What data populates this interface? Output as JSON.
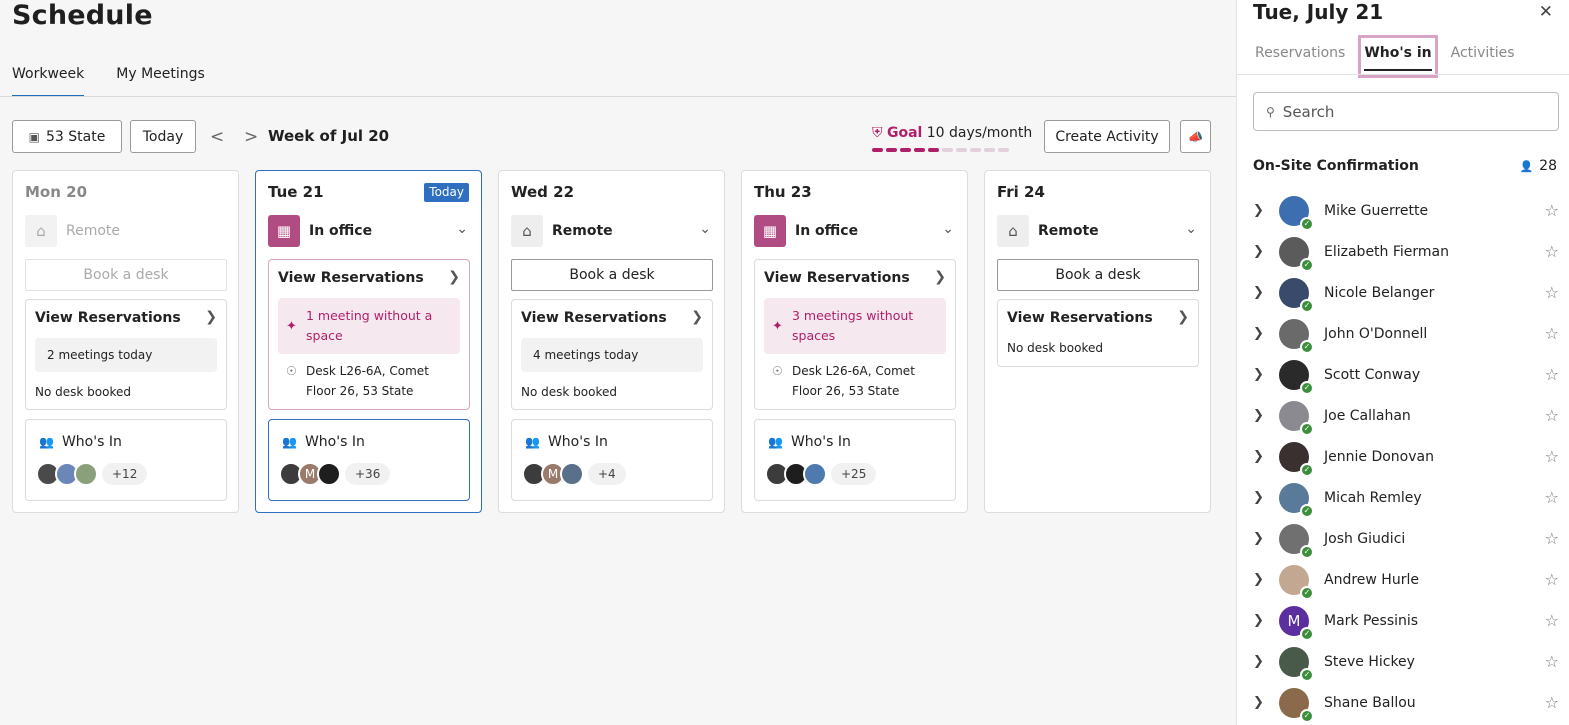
{
  "page": {
    "title": "Schedule"
  },
  "main_tabs": [
    "Workweek",
    "My Meetings"
  ],
  "toolbar": {
    "location": "53 State",
    "today": "Today",
    "prev": "<",
    "next": ">",
    "week_label": "Week of Jul 20",
    "goal_label": "Goal",
    "goal_value": "10 days/month",
    "goal_progress": {
      "filled": 5,
      "total": 10
    },
    "create_activity": "Create Activity"
  },
  "days": [
    {
      "title": "Mon 20",
      "status": "Remote",
      "book": "Book a desk",
      "view_res": "View Reservations",
      "meetings": "2 meetings today",
      "desk": "No desk booked",
      "who": "Who's In",
      "more": "+12"
    },
    {
      "title": "Tue 21",
      "badge": "Today",
      "status": "In office",
      "view_res": "View Reservations",
      "warning": "1 meeting without a space",
      "desk_line1": "Desk L26-6A, Comet",
      "desk_line2": "Floor 26, 53 State",
      "who": "Who's In",
      "more": "+36"
    },
    {
      "title": "Wed 22",
      "status": "Remote",
      "book": "Book a desk",
      "view_res": "View Reservations",
      "meetings": "4 meetings today",
      "desk": "No desk booked",
      "who": "Who's In",
      "more": "+4"
    },
    {
      "title": "Thu 23",
      "status": "In office",
      "view_res": "View Reservations",
      "warning": "3 meetings without spaces",
      "desk_line1": "Desk L26-6A, Comet",
      "desk_line2": "Floor 26, 53 State",
      "who": "Who's In",
      "more": "+25"
    },
    {
      "title": "Fri 24",
      "status": "Remote",
      "book": "Book a desk",
      "view_res": "View Reservations",
      "desk": "No desk booked"
    }
  ],
  "avatar_letters": {
    "m": "M"
  },
  "panel": {
    "date": "Tue, July 21",
    "close": "✕",
    "tabs": [
      "Reservations",
      "Who's in",
      "Activities"
    ],
    "search_placeholder": "Search",
    "section_title": "On-Site Confirmation",
    "count": "28",
    "people": [
      "Mike Guerrette",
      "Elizabeth Fierman",
      "Nicole Belanger",
      "John O'Donnell",
      "Scott Conway",
      "Joe Callahan",
      "Jennie Donovan",
      "Micah Remley",
      "Josh Giudici",
      "Andrew Hurle",
      "Mark Pessinis",
      "Steve Hickey",
      "Shane Ballou"
    ]
  },
  "colors": {
    "accent": "#2f6fc0",
    "brand": "#b0206a",
    "office": "#b04c82",
    "check": "#3b8f3b"
  },
  "icons": {
    "building": "building-icon",
    "home": "home-icon",
    "chevron": "chevron-icon",
    "people": "people-icon",
    "star": "star-icon",
    "search": "search-icon",
    "close": "close-icon",
    "spark": "sparkle-icon",
    "megaphone": "megaphone-icon",
    "desk": "desk-icon",
    "goal": "shield-icon"
  }
}
